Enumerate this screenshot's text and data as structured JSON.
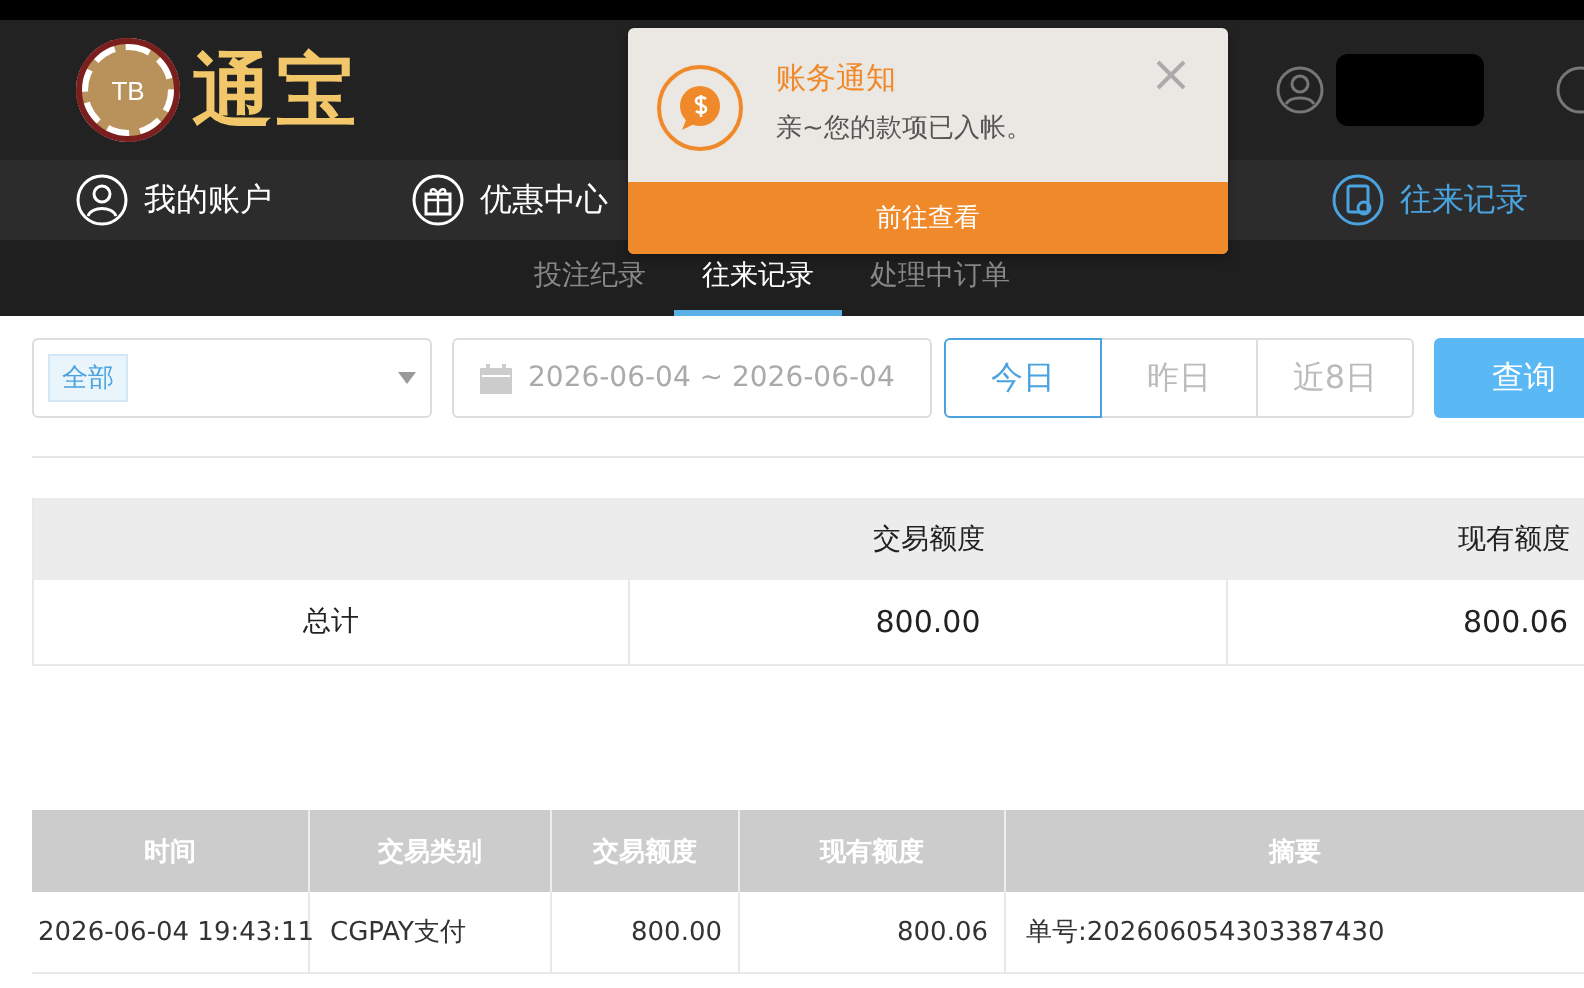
{
  "header": {
    "logo_badge": "TB",
    "logo_text": "通宝"
  },
  "nav": [
    {
      "label": "我的账户",
      "selected": false
    },
    {
      "label": "优惠中心",
      "selected": false
    },
    {
      "label": "往来记录",
      "selected": true
    }
  ],
  "subnav": [
    {
      "label": "投注纪录",
      "selected": false
    },
    {
      "label": "往来记录",
      "selected": true
    },
    {
      "label": "处理中订单",
      "selected": false
    }
  ],
  "notification": {
    "title": "账务通知",
    "message": "亲~您的款项已入帐。",
    "action": "前往查看"
  },
  "filters": {
    "type_tag": "全部",
    "date_range": "2026-06-04 ~ 2026-06-04",
    "quick": [
      {
        "label": "今日",
        "selected": true
      },
      {
        "label": "昨日",
        "selected": false
      },
      {
        "label": "近8日",
        "selected": false
      }
    ],
    "query": "查询"
  },
  "summary": {
    "columns": [
      "",
      "交易额度",
      "现有额度"
    ],
    "rows": [
      [
        "总计",
        "800.00",
        "800.06"
      ]
    ]
  },
  "table": {
    "columns": [
      "时间",
      "交易类别",
      "交易额度",
      "现有额度",
      "摘要"
    ],
    "rows": [
      [
        "2026-06-04 19:43:11",
        "CGPAY支付",
        "800.00",
        "800.06",
        "单号:202606054303387430"
      ]
    ]
  }
}
